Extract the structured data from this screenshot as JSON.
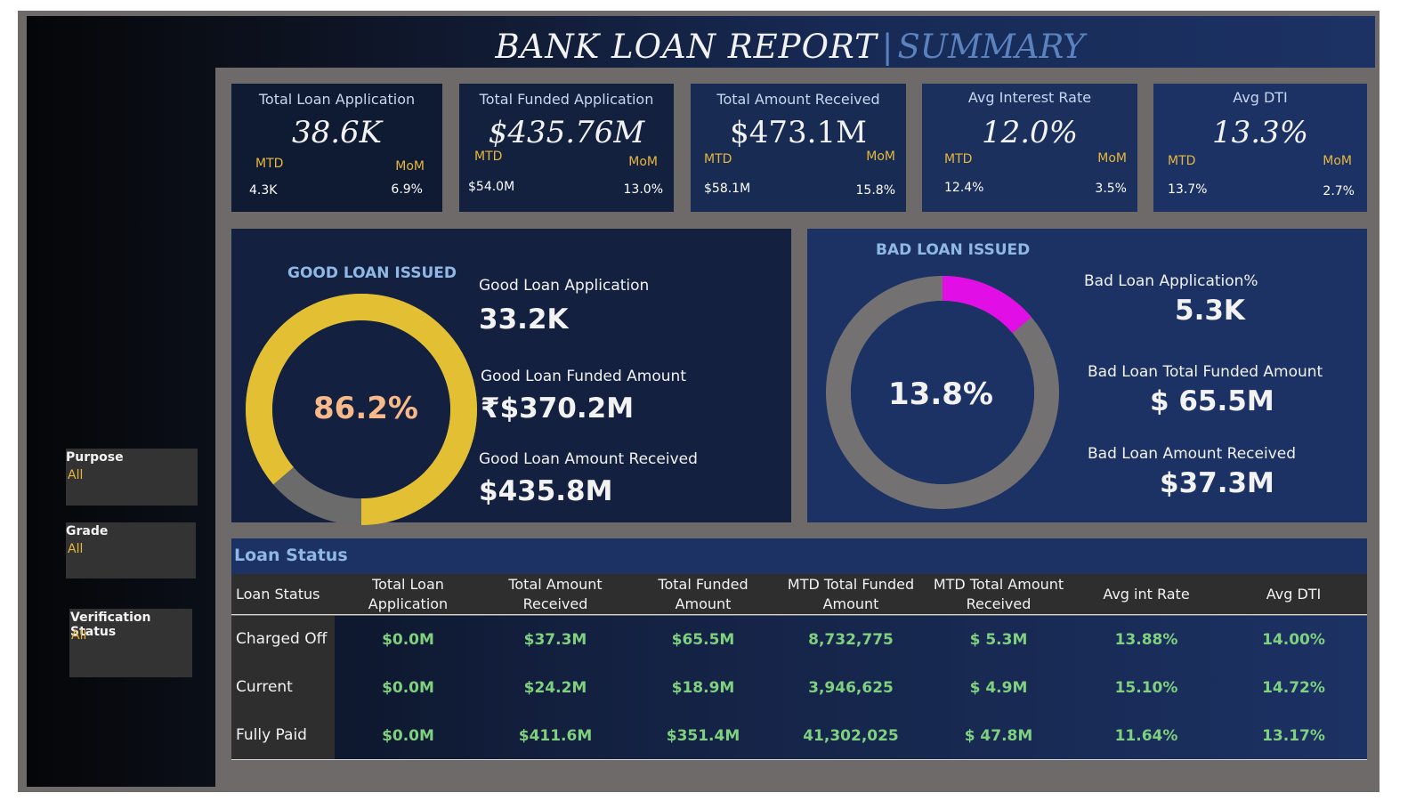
{
  "title": {
    "main": "BANK LOAN REPORT",
    "separator": "|",
    "sub": "SUMMARY"
  },
  "kpis": [
    {
      "label": "Total Loan Application",
      "value": "38.6K",
      "mtd_label": "MTD",
      "mtd_value": "4.3K",
      "mom_label": "MoM",
      "mom_value": "6.9%"
    },
    {
      "label": "Total Funded Application",
      "value": "$435.76M",
      "mtd_label": "MTD",
      "mtd_value": "$54.0M",
      "mom_label": "MoM",
      "mom_value": "13.0%"
    },
    {
      "label": "Total Amount Received",
      "value": "$473.1M",
      "mtd_label": "MTD",
      "mtd_value": "$58.1M",
      "mom_label": "MoM",
      "mom_value": "15.8%"
    },
    {
      "label": "Avg Interest Rate",
      "value": "12.0%",
      "mtd_label": "MTD",
      "mtd_value": "12.4%",
      "mom_label": "MoM",
      "mom_value": "3.5%"
    },
    {
      "label": "Avg DTI",
      "value": "13.3%",
      "mtd_label": "MTD",
      "mtd_value": "13.7%",
      "mom_label": "MoM",
      "mom_value": "2.7%"
    }
  ],
  "good_loan": {
    "title": "GOOD LOAN ISSUED",
    "percent_label": "86.2%",
    "percent": 86.2,
    "application_label": "Good Loan Application",
    "application_value": "33.2K",
    "funded_label": "Good Loan  Funded Amount",
    "funded_value": "₹$370.2M",
    "received_label": "Good Loan Amount Received",
    "received_value": "$435.8M",
    "colors": {
      "fill": "#e3bf34",
      "rest": "#6b6b6b",
      "center": "#13203f",
      "text": "#f7b98a"
    }
  },
  "bad_loan": {
    "title": "BAD LOAN ISSUED",
    "percent_label": "13.8%",
    "percent": 13.8,
    "application_label": "Bad Loan Application%",
    "application_value": "5.3K",
    "funded_label": "Bad Loan Total Funded Amount",
    "funded_value": "$ 65.5M",
    "received_label": "Bad Loan  Amount Received",
    "received_value": "$37.3M",
    "colors": {
      "fill": "#e20ee6",
      "rest": "#737171",
      "center": "#1c3264",
      "text": "#f2f2f2"
    }
  },
  "filters": [
    {
      "label": "Purpose",
      "value": "All"
    },
    {
      "label": "Grade",
      "value": "All"
    },
    {
      "label": "Verification Status",
      "value": "All"
    }
  ],
  "loan_status": {
    "title": "Loan Status",
    "headers": [
      "Loan Status",
      "Total Loan Application",
      "Total Amount Received",
      "Total Funded Amount",
      "MTD Total Funded Amount",
      "MTD Total  Amount Received",
      "Avg int Rate",
      "Avg DTI"
    ],
    "rows": [
      {
        "status": "Charged Off",
        "cells": [
          "$0.0M",
          "$37.3M",
          "$65.5M",
          "8,732,775",
          "$ 5.3M",
          "13.88%",
          "14.00%"
        ]
      },
      {
        "status": "Current",
        "cells": [
          "$0.0M",
          "$24.2M",
          "$18.9M",
          "3,946,625",
          "$ 4.9M",
          "15.10%",
          "14.72%"
        ]
      },
      {
        "status": "Fully Paid",
        "cells": [
          "$0.0M",
          "$411.6M",
          "$351.4M",
          "41,302,025",
          "$ 47.8M",
          "11.64%",
          "13.17%"
        ]
      }
    ]
  }
}
